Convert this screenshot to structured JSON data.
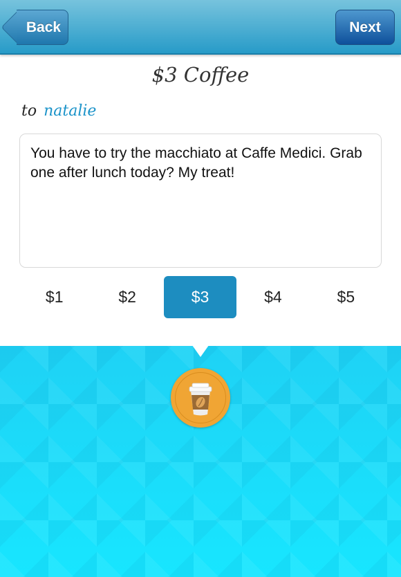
{
  "nav": {
    "back_label": "Back",
    "next_label": "Next"
  },
  "title": "$3 Coffee",
  "recipient": {
    "prefix": "to",
    "name": "natalie"
  },
  "message": "You have to try the macchiato at Caffe Medici. Grab one after lunch today? My treat!",
  "amounts": [
    {
      "label": "$1"
    },
    {
      "label": "$2"
    },
    {
      "label": "$3",
      "selected": true
    },
    {
      "label": "$4"
    },
    {
      "label": "$5"
    }
  ],
  "icon": "coffee-cup-coin-icon",
  "colors": {
    "accent": "#1d8dc0",
    "recipient": "#1b93c9",
    "coin": "#f0a534"
  }
}
